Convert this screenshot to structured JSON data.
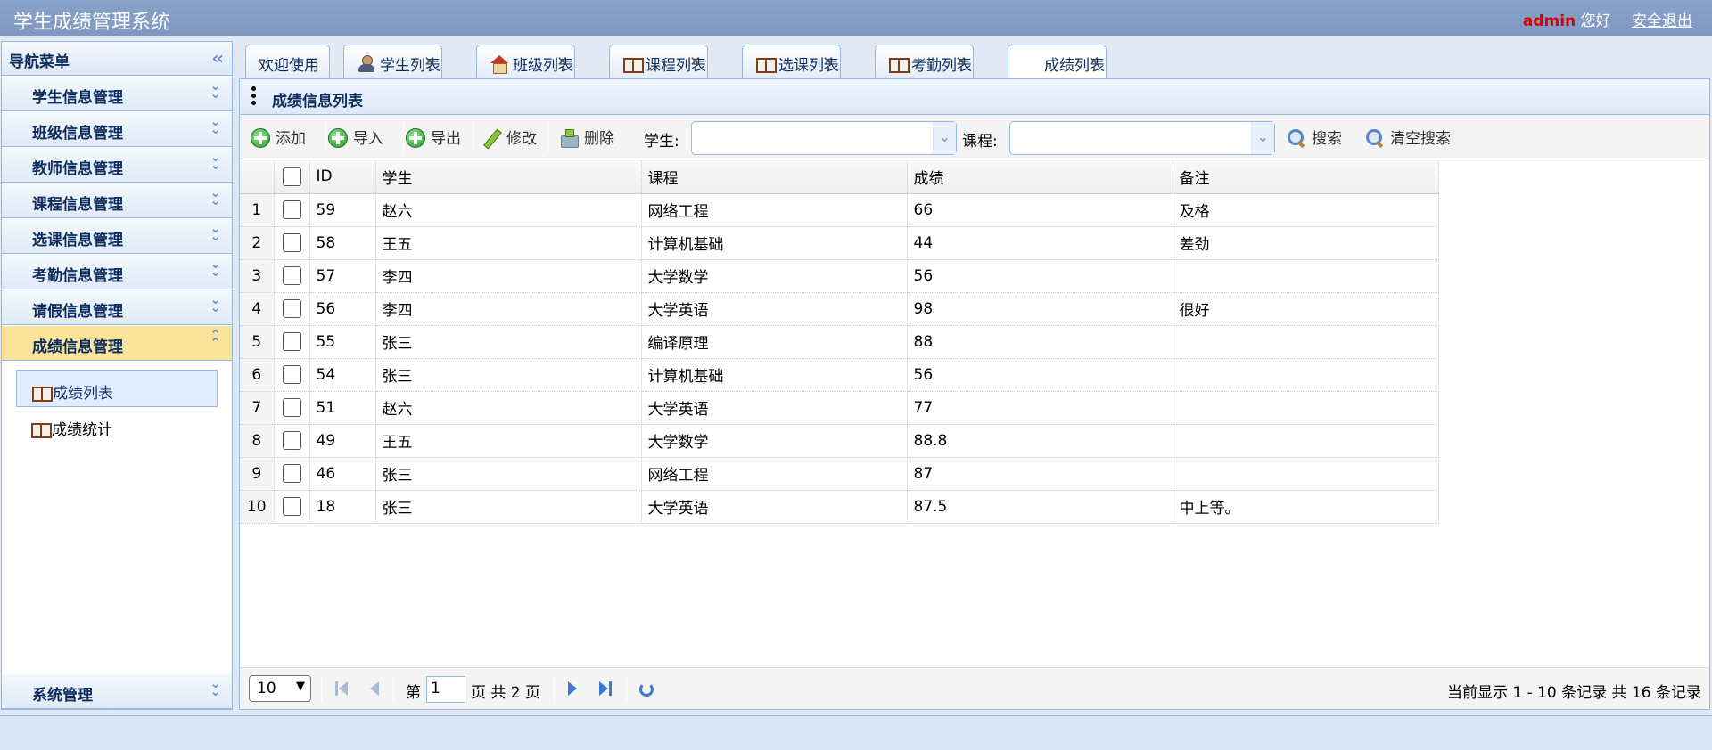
{
  "header": {
    "title": "学生成绩管理系统",
    "user": "admin",
    "greeting": "您好",
    "logout": "安全退出"
  },
  "sidebar": {
    "title": "导航菜单",
    "collapse_icon": "double-chevron-left-icon",
    "items": [
      {
        "label": "学生信息管理"
      },
      {
        "label": "班级信息管理"
      },
      {
        "label": "教师信息管理"
      },
      {
        "label": "课程信息管理"
      },
      {
        "label": "选课信息管理"
      },
      {
        "label": "考勤信息管理"
      },
      {
        "label": "请假信息管理"
      },
      {
        "label": "成绩信息管理"
      }
    ],
    "active_index": 7,
    "sub_items": [
      {
        "label": "成绩列表",
        "selected": true
      },
      {
        "label": "成绩统计",
        "selected": false
      }
    ],
    "system": "系统管理"
  },
  "tabs": [
    {
      "label": "欢迎使用",
      "icon": null,
      "closable": false
    },
    {
      "label": "学生列表",
      "icon": "person-icon",
      "closable": true
    },
    {
      "label": "班级列表",
      "icon": "house-icon",
      "closable": true
    },
    {
      "label": "课程列表",
      "icon": "book-icon",
      "closable": true
    },
    {
      "label": "选课列表",
      "icon": "book-icon",
      "closable": true
    },
    {
      "label": "考勤列表",
      "icon": "book-icon",
      "closable": true
    },
    {
      "label": "成绩列表",
      "icon": null,
      "closable": true,
      "selected": true
    }
  ],
  "panel": {
    "title": "成绩信息列表"
  },
  "toolbar": {
    "add": "添加",
    "import": "导入",
    "export": "导出",
    "edit": "修改",
    "delete": "删除",
    "student_label": "学生:",
    "student_value": "",
    "course_label": "课程:",
    "course_value": "",
    "search": "搜索",
    "clear_search": "清空搜索"
  },
  "table": {
    "columns": [
      "ID",
      "学生",
      "课程",
      "成绩",
      "备注"
    ],
    "rows": [
      {
        "n": "1",
        "id": "59",
        "student": "赵六",
        "course": "网络工程",
        "score": "66",
        "remark": "及格"
      },
      {
        "n": "2",
        "id": "58",
        "student": "王五",
        "course": "计算机基础",
        "score": "44",
        "remark": "差劲"
      },
      {
        "n": "3",
        "id": "57",
        "student": "李四",
        "course": "大学数学",
        "score": "56",
        "remark": ""
      },
      {
        "n": "4",
        "id": "56",
        "student": "李四",
        "course": "大学英语",
        "score": "98",
        "remark": "很好"
      },
      {
        "n": "5",
        "id": "55",
        "student": "张三",
        "course": "编译原理",
        "score": "88",
        "remark": ""
      },
      {
        "n": "6",
        "id": "54",
        "student": "张三",
        "course": "计算机基础",
        "score": "56",
        "remark": ""
      },
      {
        "n": "7",
        "id": "51",
        "student": "赵六",
        "course": "大学英语",
        "score": "77",
        "remark": ""
      },
      {
        "n": "8",
        "id": "49",
        "student": "王五",
        "course": "大学数学",
        "score": "88.8",
        "remark": ""
      },
      {
        "n": "9",
        "id": "46",
        "student": "张三",
        "course": "网络工程",
        "score": "87",
        "remark": ""
      },
      {
        "n": "10",
        "id": "18",
        "student": "张三",
        "course": "大学英语",
        "score": "87.5",
        "remark": "中上等。"
      }
    ]
  },
  "pager": {
    "page_size": "10",
    "page_prefix": "第",
    "page_value": "1",
    "page_suffix": "页 共 2 页",
    "info": "当前显示 1 - 10 条记录 共 16 条记录"
  }
}
